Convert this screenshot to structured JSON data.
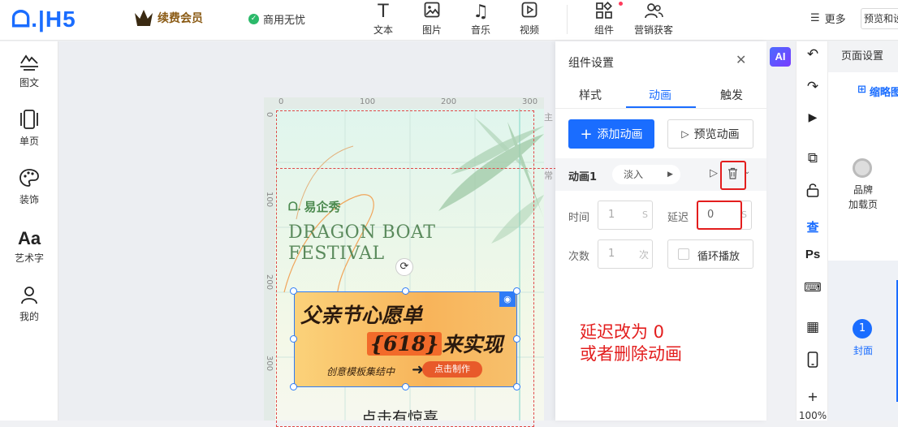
{
  "topbar": {
    "logo": "ᗝ.|H5",
    "vip_label": "续费会员",
    "commerce_label": "商用无忧",
    "tools": [
      {
        "icon": "text-icon",
        "label": "文本"
      },
      {
        "icon": "image-icon",
        "label": "图片"
      },
      {
        "icon": "music-icon",
        "label": "音乐"
      },
      {
        "icon": "video-icon",
        "label": "视频"
      },
      {
        "icon": "component-icon",
        "label": "组件"
      },
      {
        "icon": "marketing-icon",
        "label": "营销获客"
      }
    ],
    "more_label": "更多",
    "preview_label": "预览和设置"
  },
  "left_sidebar": {
    "items": [
      {
        "icon": "image-text-icon",
        "label": "图文"
      },
      {
        "icon": "single-page-icon",
        "label": "单页"
      },
      {
        "icon": "decoration-icon",
        "label": "装饰"
      },
      {
        "icon": "art-text-icon",
        "label": "艺术字"
      },
      {
        "icon": "user-icon",
        "label": "我的"
      }
    ]
  },
  "canvas": {
    "ruler_top": [
      "0",
      "100",
      "200",
      "300"
    ],
    "ruler_left": [
      "0",
      "100",
      "200",
      "300"
    ],
    "side_marks": [
      "主",
      "常"
    ],
    "brand": "易企秀",
    "headline_1": "DRAGON BOAT",
    "headline_2": "FESTIVAL",
    "banner_line1": "父亲节心愿单",
    "banner_num": "{618}",
    "banner_line2_tail": "来实现",
    "banner_sub": "创意模板集结中",
    "banner_btn": "点击制作",
    "bottom_text": "点击有惊喜"
  },
  "component_panel": {
    "title": "组件设置",
    "tabs": [
      "样式",
      "动画",
      "触发"
    ],
    "active_tab": "动画",
    "add_button": "添加动画",
    "preview_button": "预览动画",
    "animation_name": "动画1",
    "animation_type": "淡入",
    "time_label": "时间",
    "time_value": "1",
    "time_unit": "S",
    "delay_label": "延迟",
    "delay_value": "0",
    "delay_unit": "S",
    "count_label": "次数",
    "count_value": "1",
    "count_unit": "次",
    "loop_label": "循环播放"
  },
  "annotation": {
    "line1": "延迟改为 0",
    "line2": "或者删除动画"
  },
  "ai_badge": "AI",
  "right_toolbar": {
    "zoom": "100%"
  },
  "page_panel": {
    "title": "页面设置",
    "thumb_label": "缩略图",
    "brand_label_1": "品牌",
    "brand_label_2": "加载页",
    "page_number": "1",
    "page_name": "封面"
  },
  "colors": {
    "accent": "#1a6dff",
    "annotation_red": "#e31d1d"
  }
}
